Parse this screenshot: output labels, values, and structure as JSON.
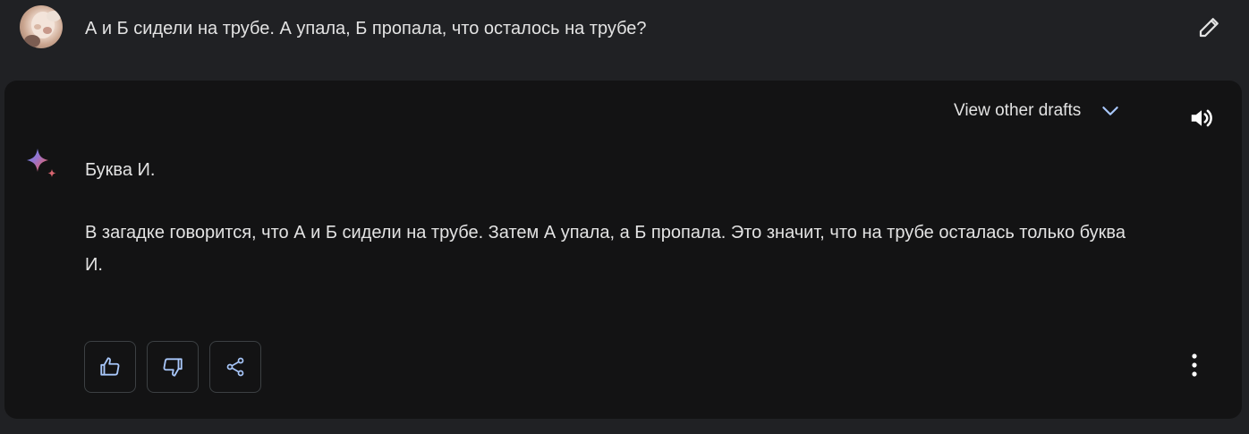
{
  "prompt": {
    "text": "А и Б сидели на трубе. А упала, Б пропала, что осталось на трубе?",
    "avatar_icon": "user-avatar",
    "edit_icon": "pencil-icon"
  },
  "response": {
    "drafts_label": "View other drafts",
    "drafts_icon": "chevron-down-icon",
    "speaker_icon": "speaker-icon",
    "assistant_icon": "gemini-sparkle-icon",
    "headline": "Буква И.",
    "body": "В загадке говорится, что А и Б сидели на трубе. Затем А упала, а Б пропала. Это значит, что на трубе осталась только буква И.",
    "actions": [
      {
        "icon": "thumbs-up-icon"
      },
      {
        "icon": "thumbs-down-icon"
      },
      {
        "icon": "share-icon"
      }
    ],
    "more_icon": "more-vert-icon"
  },
  "colors": {
    "page_background": "#202124",
    "card_background": "#131314",
    "text": "#e3e3e3",
    "accent": "#a8c7fa",
    "button_border": "#3c4043"
  }
}
